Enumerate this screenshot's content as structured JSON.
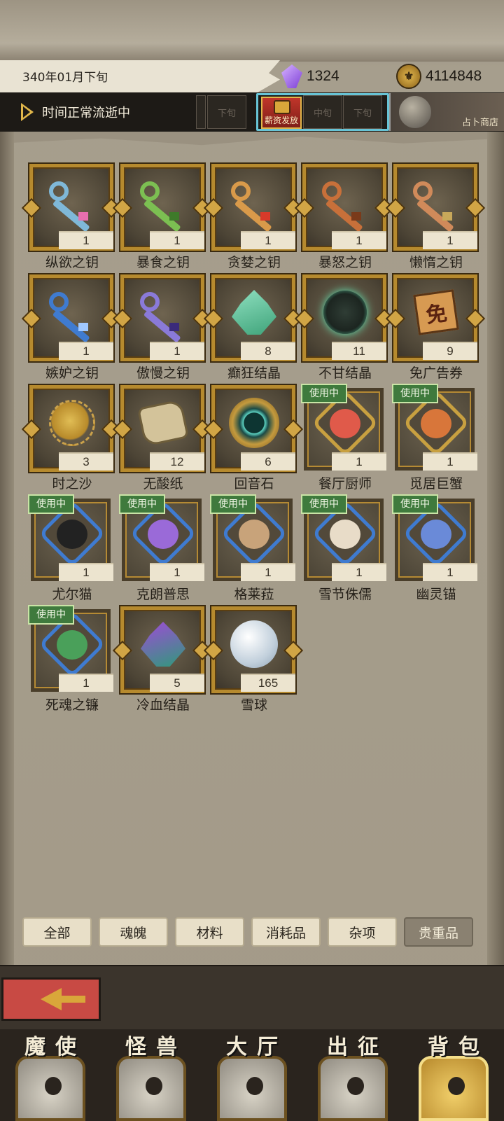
{
  "header": {
    "date": "340年01月下旬",
    "gems": "1324",
    "gold": "4114848",
    "time_status": "时间正常流逝中",
    "segments": {
      "left_late": "下旬",
      "pay_label": "薪资发放",
      "mid": "中旬",
      "late": "下旬"
    },
    "fortune_shop": "占卜商店"
  },
  "items": [
    {
      "name": "纵欲之钥",
      "count": "1",
      "kind": "key",
      "color": "#7fb8d8",
      "accent": "#e86fb0",
      "inuse": ""
    },
    {
      "name": "暴食之钥",
      "count": "1",
      "kind": "key",
      "color": "#7cbf52",
      "accent": "#3e7a2a",
      "inuse": ""
    },
    {
      "name": "贪婪之钥",
      "count": "1",
      "kind": "key",
      "color": "#d99a4a",
      "accent": "#d83a2a",
      "inuse": ""
    },
    {
      "name": "暴怒之钥",
      "count": "1",
      "kind": "key",
      "color": "#c8703a",
      "accent": "#7a3a1a",
      "inuse": ""
    },
    {
      "name": "懒惰之钥",
      "count": "1",
      "kind": "key",
      "color": "#d08a5a",
      "accent": "#c8a85a",
      "inuse": ""
    },
    {
      "name": "嫉妒之钥",
      "count": "1",
      "kind": "key",
      "color": "#3f7bd0",
      "accent": "#a0c8ff",
      "inuse": ""
    },
    {
      "name": "傲慢之钥",
      "count": "1",
      "kind": "key",
      "color": "#8a7ad8",
      "accent": "#3a2a7a",
      "inuse": ""
    },
    {
      "name": "癫狂结晶",
      "count": "8",
      "kind": "shard",
      "color": "#3fa37a",
      "accent": "#8fe0c0",
      "inuse": ""
    },
    {
      "name": "不甘结晶",
      "count": "11",
      "kind": "spiky",
      "color": "#5fe0b0",
      "accent": "#2f3d35",
      "inuse": ""
    },
    {
      "name": "免广告券",
      "count": "9",
      "kind": "ticket",
      "color": "#d79a52",
      "accent": "#5a2210",
      "glyph": "免",
      "inuse": ""
    },
    {
      "name": "时之沙",
      "count": "3",
      "kind": "sand",
      "color": "#d8b24a",
      "accent": "#8a6420",
      "inuse": ""
    },
    {
      "name": "无酸纸",
      "count": "12",
      "kind": "scroll",
      "color": "#d3c39a",
      "accent": "#6d5d3a",
      "inuse": ""
    },
    {
      "name": "回音石",
      "count": "6",
      "kind": "echo",
      "color": "#5dd3c3",
      "accent": "#c49a3e",
      "inuse": ""
    },
    {
      "name": "餐厅厨师",
      "count": "1",
      "kind": "soul",
      "color": "#c8a040",
      "accent": "#e05a4a",
      "inuse": "使用中"
    },
    {
      "name": "觅居巨蟹",
      "count": "1",
      "kind": "soul",
      "color": "#c8a040",
      "accent": "#d8763a",
      "inuse": "使用中"
    },
    {
      "name": "尤尔猫",
      "count": "1",
      "kind": "soul",
      "color": "#3f7bd0",
      "accent": "#222222",
      "inuse": "使用中"
    },
    {
      "name": "克朗普思",
      "count": "1",
      "kind": "soul",
      "color": "#3f7bd0",
      "accent": "#9a6ad8",
      "inuse": "使用中"
    },
    {
      "name": "格莱菈",
      "count": "1",
      "kind": "soul",
      "color": "#3f7bd0",
      "accent": "#c8a37a",
      "inuse": "使用中"
    },
    {
      "name": "雪节侏儒",
      "count": "1",
      "kind": "soul",
      "color": "#3f7bd0",
      "accent": "#e8dcc8",
      "inuse": "使用中"
    },
    {
      "name": "幽灵锚",
      "count": "1",
      "kind": "soul",
      "color": "#3f7bd0",
      "accent": "#6a8ad8",
      "inuse": "使用中"
    },
    {
      "name": "死魂之镰",
      "count": "1",
      "kind": "soul",
      "color": "#3f7bd0",
      "accent": "#4aa05a",
      "inuse": "使用中"
    },
    {
      "name": "冷血结晶",
      "count": "5",
      "kind": "shard",
      "color": "#2f9a7a",
      "accent": "#a04ad8",
      "inuse": ""
    },
    {
      "name": "雪球",
      "count": "165",
      "kind": "snow",
      "color": "#e8eef5",
      "accent": "#8ea2b4",
      "inuse": ""
    }
  ],
  "filter_tabs": [
    {
      "label": "全部",
      "active": false
    },
    {
      "label": "魂魄",
      "active": false
    },
    {
      "label": "材料",
      "active": false
    },
    {
      "label": "消耗品",
      "active": false
    },
    {
      "label": "杂项",
      "active": false
    },
    {
      "label": "贵重品",
      "active": true
    }
  ],
  "nav": [
    {
      "label": "魔使",
      "active": false
    },
    {
      "label": "怪兽",
      "active": false
    },
    {
      "label": "大厅",
      "active": false
    },
    {
      "label": "出征",
      "active": false
    },
    {
      "label": "背包",
      "active": true
    }
  ],
  "colors": {
    "frame_gold": "#b68a2e",
    "inuse_green": "#3f7a3d",
    "back_red": "#c84a44"
  }
}
